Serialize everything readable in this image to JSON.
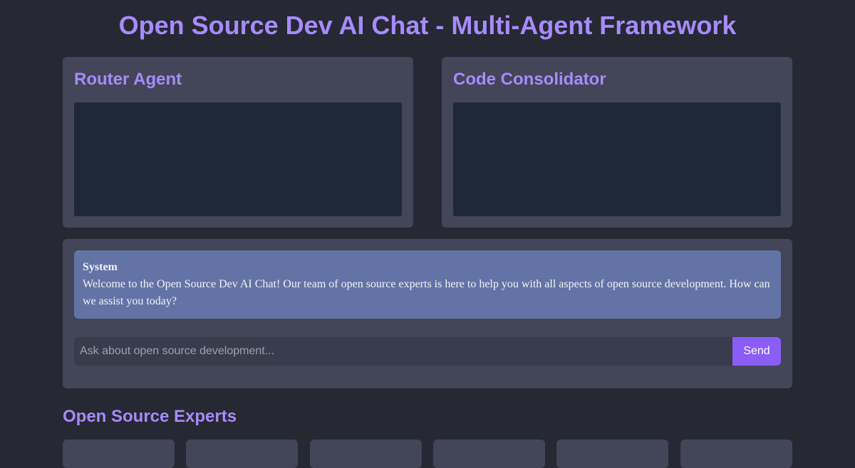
{
  "page": {
    "title": "Open Source Dev AI Chat - Multi-Agent Framework"
  },
  "agents": {
    "router": {
      "title": "Router Agent"
    },
    "consolidator": {
      "title": "Code Consolidator"
    }
  },
  "chat": {
    "messages": [
      {
        "sender": "System",
        "text": "Welcome to the Open Source Dev AI Chat! Our team of open source experts is here to help you with all aspects of open source development. How can we assist you today?"
      }
    ],
    "input": {
      "value": "",
      "placeholder": "Ask about open source development..."
    },
    "send_label": "Send"
  },
  "experts": {
    "heading": "Open Source Experts"
  },
  "colors": {
    "background": "#262833",
    "panel": "#434558",
    "accent": "#a78bfa",
    "button": "#8b5cf6",
    "message": "#6473a6",
    "output_area": "#1f2838"
  }
}
